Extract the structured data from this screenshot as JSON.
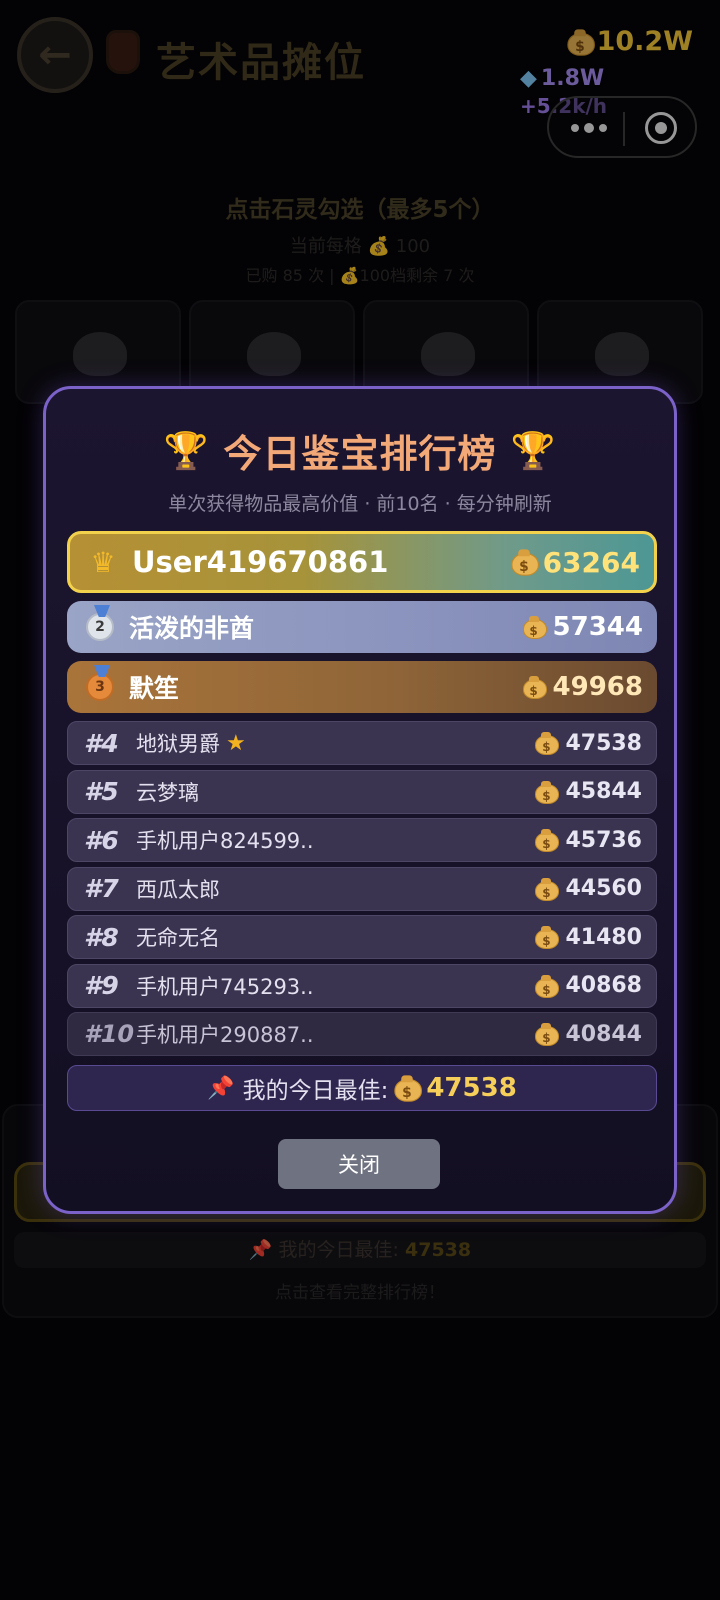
{
  "header": {
    "title": "艺术品摊位",
    "gold": "10.2W",
    "gems": "1.8W",
    "rate": "+5.2k/h"
  },
  "background": {
    "hint_title": "点击石灵勾选（最多5个）",
    "price_text": "当前每格 💰 100",
    "purchase_text": "已购 85 次 | 💰100档剩余 7 次",
    "my_best_label": "📌 我的今日最佳:",
    "my_best_value": "47538",
    "view_link": "点击查看完整排行榜！"
  },
  "leaderboard": {
    "title": "今日鉴宝排行榜",
    "subtitle": "单次获得物品最高价值 · 前10名 · 每分钟刷新",
    "top": [
      {
        "rank": "1",
        "name": "User419670861",
        "score": "63264",
        "icon": "crown-icon"
      },
      {
        "rank": "2",
        "name": "活泼的非酋",
        "score": "57344",
        "icon": "silver-medal-icon"
      },
      {
        "rank": "3",
        "name": "默笙",
        "score": "49968",
        "icon": "bronze-medal-icon"
      }
    ],
    "rows": [
      {
        "rank": "#4",
        "name": "地狱男爵",
        "score": "47538",
        "starred": true
      },
      {
        "rank": "#5",
        "name": "云梦璃",
        "score": "45844"
      },
      {
        "rank": "#6",
        "name": "手机用户824599..",
        "score": "45736"
      },
      {
        "rank": "#7",
        "name": "西瓜太郎",
        "score": "44560"
      },
      {
        "rank": "#8",
        "name": "无命无名",
        "score": "41480"
      },
      {
        "rank": "#9",
        "name": "手机用户745293..",
        "score": "40868"
      },
      {
        "rank": "#10",
        "name": "手机用户290887..",
        "score": "40844"
      }
    ],
    "my_best_label": "我的今日最佳:",
    "my_best_value": "47538",
    "close_label": "关闭"
  },
  "colors": {
    "accent_gold": "#f3c53a",
    "modal_border": "#7b62c9",
    "title_orange": "#f3a877"
  }
}
